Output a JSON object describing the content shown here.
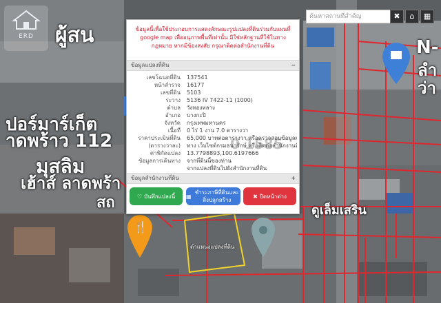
{
  "header": {
    "logo_text": "ERD",
    "search_placeholder": "ค้นหาสถานที่สำคัญ",
    "close_label": "✖",
    "home_label": "⌂",
    "grid_label": "▦"
  },
  "map_labels": {
    "left_top": "ผู้สน",
    "left_mid": "ปอร์มาร์เก็ต",
    "left_mid2": "าดพร้าว 112",
    "left_low": "มุสลิม",
    "left_low2": "เฮ้าส์ ลาดพร้า",
    "left_low3": "สถ",
    "right_top": "N-",
    "right_top2": "ลำ",
    "right_top3": "ว่า",
    "bottom_right": "ดูเล็มเสริน"
  },
  "popup": {
    "intro": "ข้อมูลนี้เพื่อใช้ประกอบการแสดงลักษณะรูปแปลงที่ดินร่วมกับแผนที่ google map เพื่ออนุภาพพื้นที่เท่านั้น มิใช่หลักฐานที่ใช้ในทางกฎหมาย หากมีข้องสงสัย กรุณาติดต่อสำนักงานที่ดิน",
    "parcel_section": "ข้อมูลแปลงที่ดิน",
    "parcel_toggle": "−",
    "rows": [
      {
        "k": "เลขโฉนดที่ดิน",
        "v": "137541"
      },
      {
        "k": "หน้าสำรวจ",
        "v": "16177"
      },
      {
        "k": "เลขที่ดิน",
        "v": "5103"
      },
      {
        "k": "ระวาง",
        "v": "5136 IV 7422-11 (1000)"
      },
      {
        "k": "ตำบล",
        "v": "วังทองหลาง"
      },
      {
        "k": "อำเภอ",
        "v": "บางกะปิ"
      },
      {
        "k": "จังหวัด",
        "v": "กรุงเทพมหานคร"
      },
      {
        "k": "เนื้อที่",
        "v": "0 ไร่ 1 งาน 7.0 ตารางวา"
      },
      {
        "k": "ราคาประเมินที่ดิน",
        "v": "65,000 บาทต่อตารางวา หรือตรวจสอบข้อมูลผ่าน"
      },
      {
        "k": "(ตารางวาละ)",
        "v": "ทาง เว็บไซต์กรมธนารักษ์ หรือติดต่อสำนักงานที่ดิน"
      },
      {
        "k": "ค่าพิกัดแปลง",
        "v": "13.7798893,100.6197666"
      },
      {
        "k": "ข้อมูลการเดินทาง",
        "v": "จากที่ดินนี้ของท่าน"
      },
      {
        "k": "",
        "v": "จากแปลงที่ดินไปยังสำนักงานที่ดิน"
      }
    ],
    "watermark": "0 1585",
    "office_section": "ข้อมูลสำนักงานที่ดิน",
    "office_toggle": "+",
    "buttons": {
      "save_icon": "♡",
      "save": "บันทึกแปลงนี้",
      "pay_icon": "▦",
      "pay": "ชำระภาษีที่ดินและสิ่งปลูกสร้าง",
      "close_icon": "✖",
      "close": "ปิดหน้าต่าง"
    }
  },
  "parcel_label": "ตำแหน่งแปลงที่ดิน",
  "colors": {
    "intro_red": "#d2192b",
    "save_green": "#2fa84f",
    "pay_blue": "#3d7ad9",
    "close_red": "#e0343f",
    "parcel_border": "#f2d32a",
    "boundary_red": "#e0262e"
  }
}
